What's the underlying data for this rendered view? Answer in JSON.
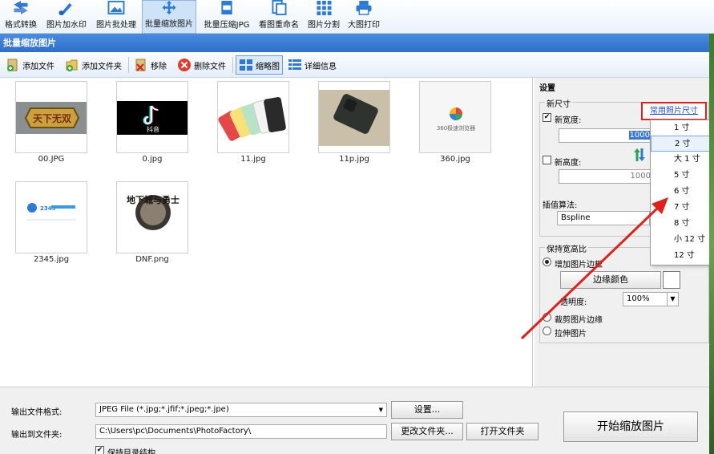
{
  "toolbar": {
    "items": [
      {
        "label": "格式转换",
        "icon": "convert-icon"
      },
      {
        "label": "图片加水印",
        "icon": "watermark-brush-icon"
      },
      {
        "label": "图片批处理",
        "icon": "image-batch-icon"
      },
      {
        "label": "批量缩放图片",
        "icon": "resize-arrows-icon",
        "active": true
      },
      {
        "label": "批量压缩JPG",
        "icon": "jpg-compress-icon"
      },
      {
        "label": "看图重命名",
        "icon": "rename-icon"
      },
      {
        "label": "图片分割",
        "icon": "grid-split-icon"
      },
      {
        "label": "大图打印",
        "icon": "printer-icon"
      }
    ]
  },
  "title": "批量缩放图片",
  "subtoolbar": {
    "add_file": "添加文件",
    "add_folder": "添加文件夹",
    "remove": "移除",
    "delete_file": "删除文件",
    "thumbnails": "缩略图",
    "details": "详细信息"
  },
  "images": [
    {
      "name": "00.JPG",
      "thumb_text": "天下无双"
    },
    {
      "name": "0.jpg",
      "thumb_text": "抖音"
    },
    {
      "name": "11.jpg",
      "thumb_text": ""
    },
    {
      "name": "11p.jpg",
      "thumb_text": ""
    },
    {
      "name": "360.jpg",
      "thumb_text": "360极速浏览器"
    },
    {
      "name": "2345.jpg",
      "thumb_text": "2345"
    },
    {
      "name": "DNF.png",
      "thumb_text": "地下城与勇士"
    }
  ],
  "settings": {
    "title": "设置",
    "new_size_caption": "新尺寸",
    "common_size_link": "常用照片尺寸",
    "new_width_label": "新宽度:",
    "new_width_value": "1000",
    "new_width_checked": true,
    "new_height_label": "新高度:",
    "new_height_value": "1000",
    "new_height_checked": false,
    "interp_label": "插值算法:",
    "interp_value": "Bspline",
    "keep_ratio_caption": "保持宽高比",
    "add_border_label": "增加图片边框",
    "border_color_button": "边缘颜色",
    "opacity_label": "透明度:",
    "opacity_value": "100%",
    "crop_border_label": "裁剪图片边缘",
    "stretch_label": "拉伸图片"
  },
  "size_dropdown": {
    "items": [
      "1 寸",
      "2 寸",
      "大 1 寸",
      "5 寸",
      "6 寸",
      "7 寸",
      "8 寸",
      "小 12 寸",
      "12 寸"
    ],
    "selected_index": 1
  },
  "bottom": {
    "format_label": "输出文件格式:",
    "format_value": "JPEG File (*.jpg;*.jfif;*.jpeg;*.jpe)",
    "settings_button": "设置...",
    "folder_label": "输出到文件夹:",
    "folder_value": "C:\\Users\\pc\\Documents\\PhotoFactory\\",
    "change_folder_button": "更改文件夹...",
    "open_folder_button": "打开文件夹",
    "keep_structure_label": "保持目录结构",
    "keep_structure_checked": true,
    "start_button": "开始缩放图片"
  },
  "colors": {
    "title_bar": "#2f6fc9",
    "highlight_box": "#e0201b",
    "link": "#1a4ed0",
    "annotation_arrow": "#e0201b"
  }
}
